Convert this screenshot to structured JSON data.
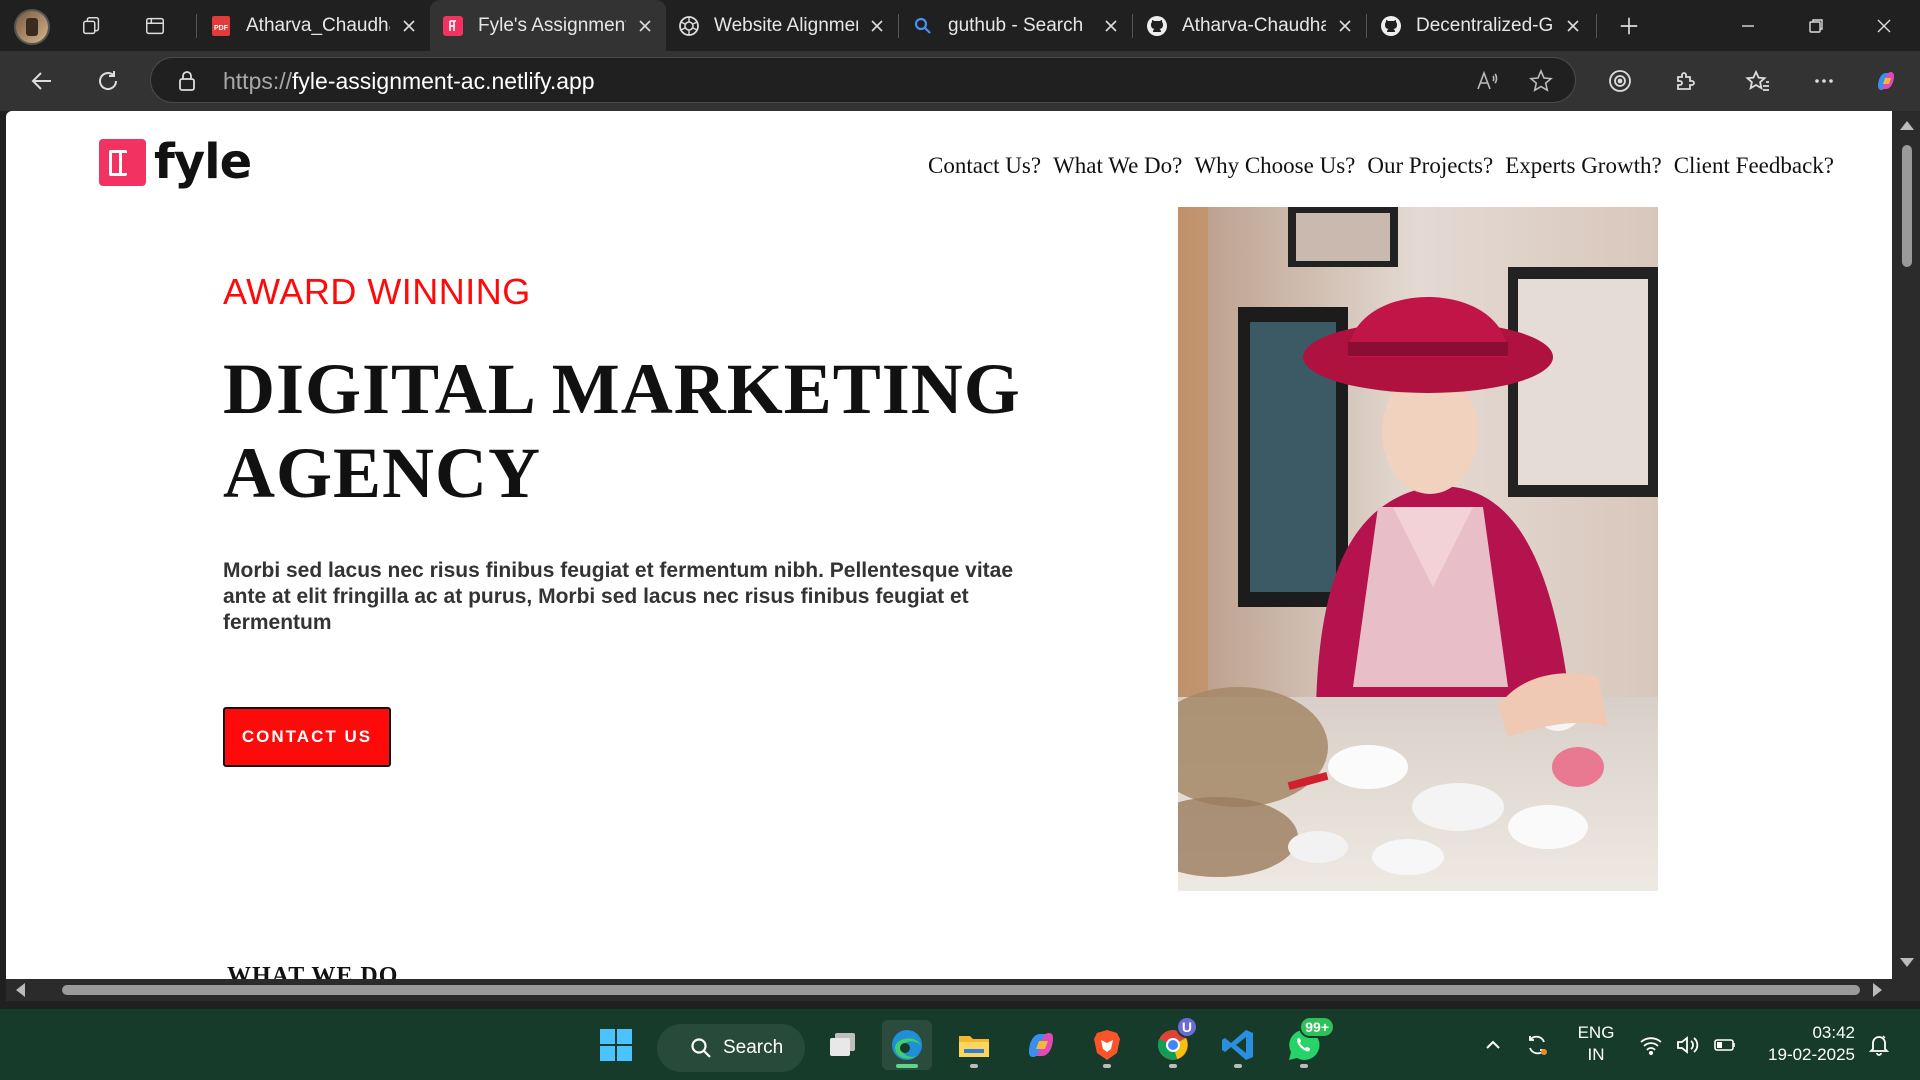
{
  "browser": {
    "tabs": [
      {
        "title": "Atharva_Chaudhari_Resume.pdf",
        "icon": "pdf-icon",
        "active": false
      },
      {
        "title": "Fyle's Assignment",
        "icon": "fyle-favicon",
        "active": true
      },
      {
        "title": "Website Alignment",
        "icon": "chatgpt-icon",
        "active": false
      },
      {
        "title": "guthub - Search",
        "icon": "search-icon",
        "active": false
      },
      {
        "title": "Atharva-Chaudhari",
        "icon": "github-icon",
        "active": false
      },
      {
        "title": "Decentralized-Governance",
        "icon": "github-icon",
        "active": false
      }
    ],
    "address": {
      "scheme": "https://",
      "host": "fyle-assignment-ac.netlify.app"
    }
  },
  "page": {
    "logo_text": "fyle",
    "nav": [
      "Contact Us?",
      "What We Do?",
      "Why Choose Us?",
      "Our Projects?",
      "Experts Growth?",
      "Client Feedback?"
    ],
    "hero": {
      "eyebrow": "AWARD WINNING",
      "title_line1": "DIGITAL MARKETING",
      "title_line2": "AGENCY",
      "body": "Morbi sed lacus nec risus finibus feugiat et fermentum nibh. Pellentesque vitae ante at elit fringilla ac at purus, Morbi sed lacus nec risus finibus feugiat et fermentum",
      "cta_label": "CONTACT US"
    },
    "next_section_heading": "WHAT WE DO",
    "colors": {
      "accent": "#ff0a0a",
      "logo": "#f23361",
      "text": "#111111"
    }
  },
  "taskbar": {
    "search_label": "Search",
    "chrome_badge": "U",
    "whatsapp_badge": "99+",
    "lang_line1": "ENG",
    "lang_line2": "IN",
    "time": "03:42",
    "date": "19-02-2025"
  }
}
